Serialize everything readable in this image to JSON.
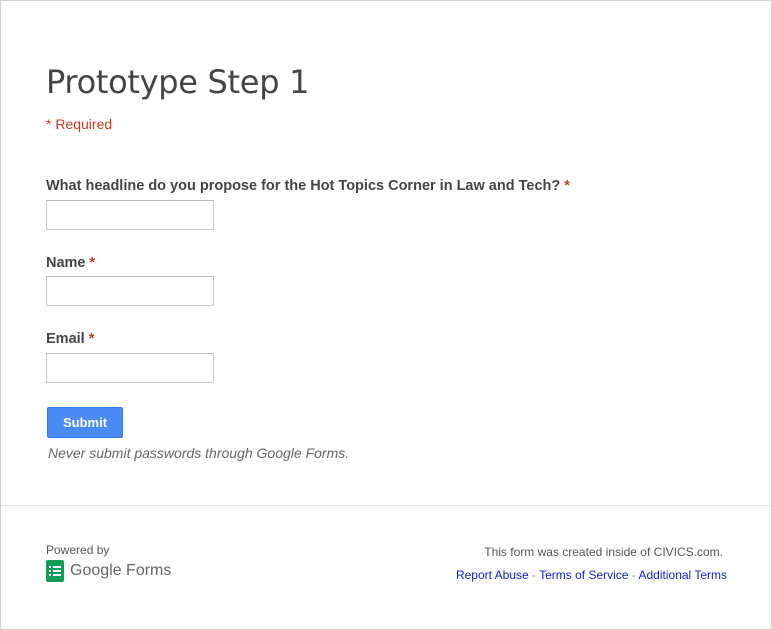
{
  "form": {
    "title": "Prototype Step 1",
    "required_note": "* Required",
    "questions": [
      {
        "label": "What headline do you propose for the Hot Topics Corner in Law and Tech?",
        "required_mark": "*",
        "value": ""
      },
      {
        "label": "Name",
        "required_mark": "*",
        "value": ""
      },
      {
        "label": "Email",
        "required_mark": "*",
        "value": ""
      }
    ],
    "submit_label": "Submit",
    "password_warning": "Never submit passwords through Google Forms."
  },
  "footer": {
    "powered_by": "Powered by",
    "logo_text": "Google Forms",
    "logo_icon": "google-forms-icon",
    "created_note": "This form was created inside of CIVICS.com.",
    "links": [
      {
        "label": "Report Abuse"
      },
      {
        "label": "Terms of Service"
      },
      {
        "label": "Additional Terms"
      }
    ],
    "separator": " - "
  },
  "colors": {
    "required": "#c43b1d",
    "submit_bg": "#4a8bf5",
    "link": "#1122cc",
    "forms_green": "#0f9d58"
  }
}
